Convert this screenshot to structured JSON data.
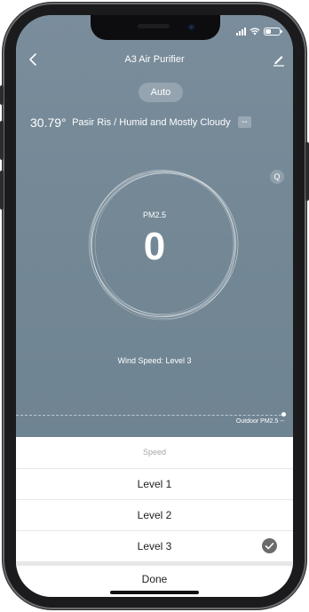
{
  "nav": {
    "title": "A3 Air Purifier"
  },
  "mode": {
    "label": "Auto"
  },
  "weather": {
    "temperature": "30.79°",
    "location": "Pasir Ris / Humid and Mostly Cloudy",
    "aqi_badge": "--"
  },
  "q_icon": {
    "label": "Q"
  },
  "pm": {
    "label": "PM2.5",
    "value": "0"
  },
  "wind": {
    "text": "Wind Speed: Level 3"
  },
  "outdoor": {
    "text": "Outdoor PM2.5 --"
  },
  "sheet": {
    "title": "Speed",
    "options": [
      {
        "label": "Level 1",
        "selected": false
      },
      {
        "label": "Level 2",
        "selected": false
      },
      {
        "label": "Level 3",
        "selected": true
      }
    ],
    "done_label": "Done"
  },
  "colors": {
    "background": "#778b9a",
    "sheet": "#ffffff",
    "check": "#6b6b6b"
  },
  "icons": [
    "back-chevron-icon",
    "edit-pencil-icon",
    "signal-icon",
    "wifi-icon",
    "battery-icon",
    "checkmark-icon"
  ]
}
